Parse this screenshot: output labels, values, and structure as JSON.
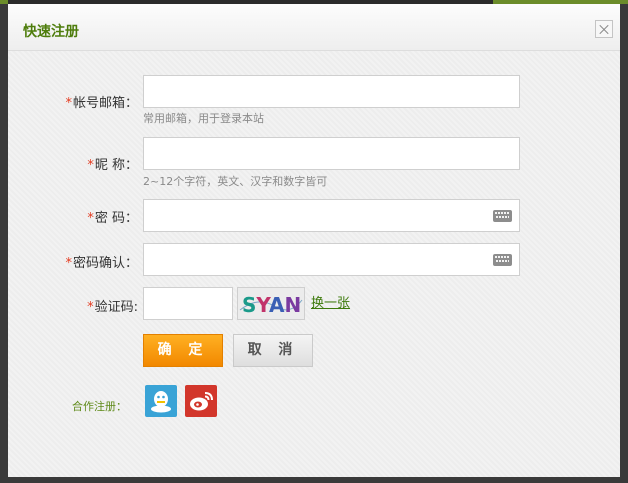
{
  "dialog": {
    "title": "快速注册",
    "close_icon": "close-icon"
  },
  "form": {
    "required_mark": "*",
    "account": {
      "label": "帐号邮箱：",
      "value": "",
      "hint": "常用邮箱，用于登录本站"
    },
    "nickname": {
      "label": "昵 称：",
      "value": "",
      "hint": "2~12个字符，英文、汉字和数字皆可"
    },
    "password": {
      "label": "密 码：",
      "value": "",
      "icon": "keyboard-icon"
    },
    "password_confirm": {
      "label": "密码确认：",
      "value": "",
      "icon": "keyboard-icon"
    },
    "captcha": {
      "label": "验证码:",
      "value": "",
      "image_text": "SYAN",
      "refresh_link": "换一张"
    }
  },
  "buttons": {
    "confirm": "确 定",
    "cancel": "取 消"
  },
  "partner": {
    "label": "合作注册：",
    "icons": [
      "qq-icon",
      "weibo-icon"
    ]
  },
  "colors": {
    "title": "#4e7d0c",
    "required": "#e33a1f",
    "confirm_button": "#f59400",
    "qq": "#39a3d6",
    "weibo": "#d2362b",
    "link": "#3d7a0c"
  }
}
